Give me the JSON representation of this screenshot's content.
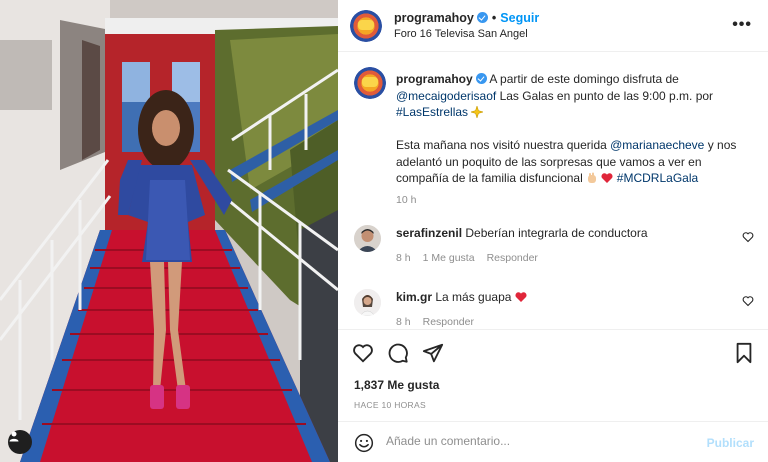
{
  "post": {
    "username": "programahoy",
    "follow_label": "Seguir",
    "separator": "•",
    "location": "Foro 16 Televisa San Angel",
    "more_label": "•••"
  },
  "caption": {
    "username": "programahoy",
    "part1": "A partir de este domingo disfruta de ",
    "mention1": "@mecaigoderisaof",
    "part2": " Las Galas en punto de las 9:00 p.m. por ",
    "hashtag1": "#LasEstrellas",
    "part3": "Esta mañana nos visitó nuestra querida ",
    "mention2": "@marianaecheve",
    "part4": " y nos adelantó un poquito de las sorpresas que vamos a ver en compañía de la familia disfuncional ",
    "hashtag2": "#MCDRLaGala",
    "time": "10 h"
  },
  "comments": [
    {
      "username": "serafinzenil",
      "text": "Deberían integrarla de conductora",
      "time": "8 h",
      "likes": "1 Me gusta",
      "reply": "Responder"
    },
    {
      "username": "kim.gr",
      "text": "La más guapa",
      "time": "8 h",
      "reply": "Responder"
    }
  ],
  "stats": {
    "likes": "1,837 Me gusta",
    "posted_ago": "HACE 10 HORAS"
  },
  "composer": {
    "placeholder": "Añade un comentario...",
    "publish_label": "Publicar"
  },
  "colors": {
    "accent": "#0095f6",
    "verified": "#3897f0",
    "link": "#00376b",
    "heart": "#ed4956",
    "muted": "#8e8e8e"
  },
  "icons": {
    "like": "heart-icon",
    "comment": "comment-icon",
    "share": "paper-plane-icon",
    "save": "bookmark-icon",
    "emoji": "smiley-icon",
    "more": "ellipsis-icon",
    "tag": "user-tag-icon"
  }
}
